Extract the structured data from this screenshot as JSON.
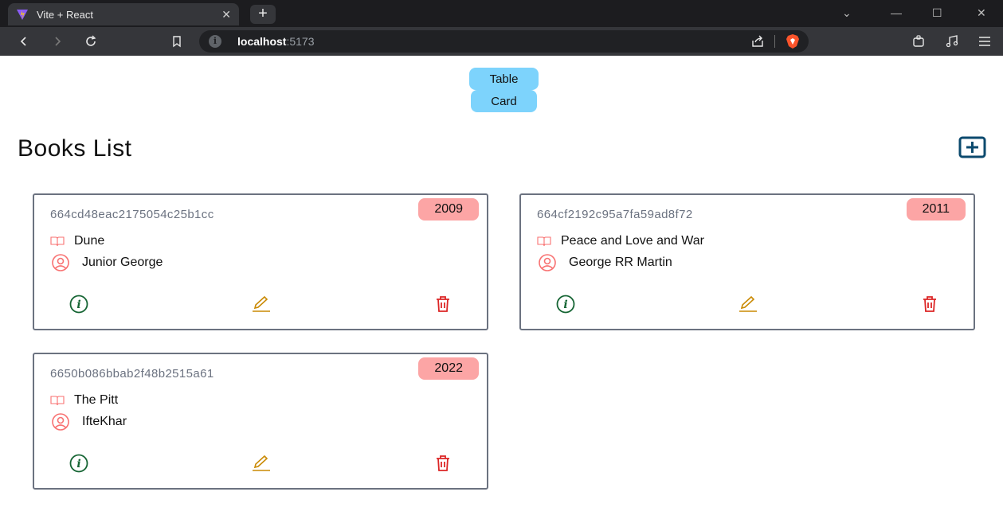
{
  "browser": {
    "tab_title": "Vite + React",
    "url_host": "localhost",
    "url_port": ":5173"
  },
  "view_toggle": {
    "table_label": "Table",
    "card_label": "Card"
  },
  "page_title": "Books List",
  "books": [
    {
      "id": "664cd48eac2175054c25b1cc",
      "year": "2009",
      "title": "Dune",
      "author": "Junior George"
    },
    {
      "id": "664cf2192c95a7fa59ad8f72",
      "year": "2011",
      "title": "Peace and Love and War",
      "author": "George RR Martin"
    },
    {
      "id": "6650b086bbab2f48b2515a61",
      "year": "2022",
      "title": "The Pitt",
      "author": "IfteKhar"
    }
  ],
  "colors": {
    "toggle_bg": "#7dd3fc",
    "year_badge_bg": "#fca5a5",
    "info_icon": "#166534",
    "edit_icon": "#ca8a04",
    "delete_icon": "#dc2626",
    "add_icon": "#0c4a6e"
  }
}
